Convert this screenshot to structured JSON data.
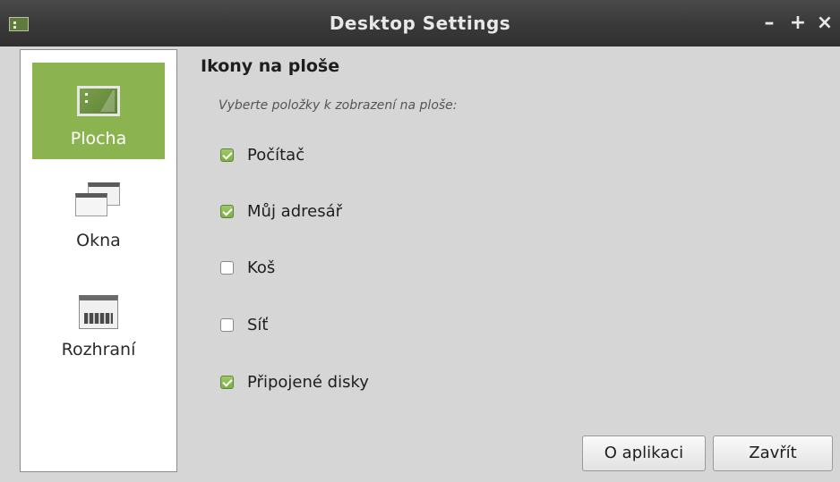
{
  "window": {
    "title": "Desktop Settings",
    "controls": {
      "minimize": "–",
      "maximize": "+",
      "close": "×"
    }
  },
  "sidebar": {
    "items": [
      {
        "label": "Plocha",
        "icon": "desktop-icon",
        "active": true
      },
      {
        "label": "Okna",
        "icon": "windows-icon",
        "active": false
      },
      {
        "label": "Rozhraní",
        "icon": "interface-icon",
        "active": false
      }
    ]
  },
  "main": {
    "heading": "Ikony na ploše",
    "subtitle": "Vyberte položky k zobrazení na ploše:",
    "options": [
      {
        "label": "Počítač",
        "checked": true
      },
      {
        "label": "Můj adresář",
        "checked": true
      },
      {
        "label": "Koš",
        "checked": false
      },
      {
        "label": "Síť",
        "checked": false
      },
      {
        "label": "Připojené disky",
        "checked": true
      }
    ]
  },
  "buttons": {
    "about": "O aplikaci",
    "close": "Zavřít"
  },
  "colors": {
    "accent": "#8bb34f",
    "titlebar": "#3a3a3a",
    "background": "#d6d6d6"
  }
}
